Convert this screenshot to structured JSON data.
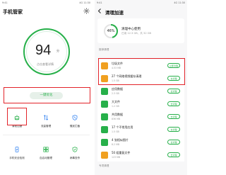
{
  "left": {
    "status": {
      "left": "9:41",
      "right": "4G 11:30"
    },
    "title": "手机管家",
    "score": "94",
    "score_unit": "分",
    "score_caption": "点击查看详情",
    "optimize_label": "一键优化",
    "tools": [
      {
        "label": "清理加速",
        "icon": "broom-icon",
        "color": "#27b04a"
      },
      {
        "label": "流量管理",
        "icon": "traffic-icon",
        "color": "#2d7ff0"
      },
      {
        "label": "骚扰拦截",
        "icon": "shield-block-icon",
        "color": "#2d7ff0"
      },
      {
        "label": "手机安全检测",
        "icon": "phone-check-icon",
        "color": "#2d7ff0"
      },
      {
        "label": "自启动管理",
        "icon": "startup-icon",
        "color": "#27b04a"
      },
      {
        "label": "病毒查杀",
        "icon": "virus-icon",
        "color": "#27b04a"
      }
    ]
  },
  "right": {
    "status": {
      "left": "9:41",
      "right": "4G 11:30"
    },
    "title": "清理加速",
    "hero": {
      "percent": "46%",
      "title": "清理中心使用",
      "subtitle": "已用 12.3 GB，共 32 GB"
    },
    "section_title": "推荐清理",
    "items": [
      {
        "title": "垃圾文件",
        "size": "4.53 MB",
        "button": "立即清理",
        "icon": "trash-icon",
        "color": "#f0a020"
      },
      {
        "title": "27 个网络视频缓存清理",
        "size": "1.5 GB",
        "button": "去清理",
        "icon": "video-icon",
        "color": "#f0a020"
      },
      {
        "title": "应用数据",
        "size": "2.3 GB",
        "button": "去清理",
        "icon": "app-icon",
        "color": "#27b04a"
      },
      {
        "title": "大文件",
        "size": "1.2 GB",
        "button": "去清理",
        "icon": "file-icon",
        "color": "#27b04a"
      },
      {
        "title": "共用数据",
        "size": "836 MB",
        "button": "去清理",
        "icon": "share-icon",
        "color": "#27b04a"
      },
      {
        "title": "17 个不常用应用",
        "size": "1.5 GB",
        "button": "去清理",
        "icon": "app-unused-icon",
        "color": "#27b04a"
      },
      {
        "title": "4 张相似图片",
        "size": "8.2 MB",
        "button": "去清理",
        "icon": "image-icon",
        "color": "#27b04a"
      },
      {
        "title": "50 组重复文件",
        "size": "123 MB",
        "button": "去清理",
        "icon": "duplicate-icon",
        "color": "#f0a020"
      }
    ],
    "bottom_section": "专项清理"
  },
  "colors": {
    "accent": "#27b04a",
    "highlight": "#e2242a",
    "blue": "#2d7ff0",
    "orange": "#f0a020"
  }
}
